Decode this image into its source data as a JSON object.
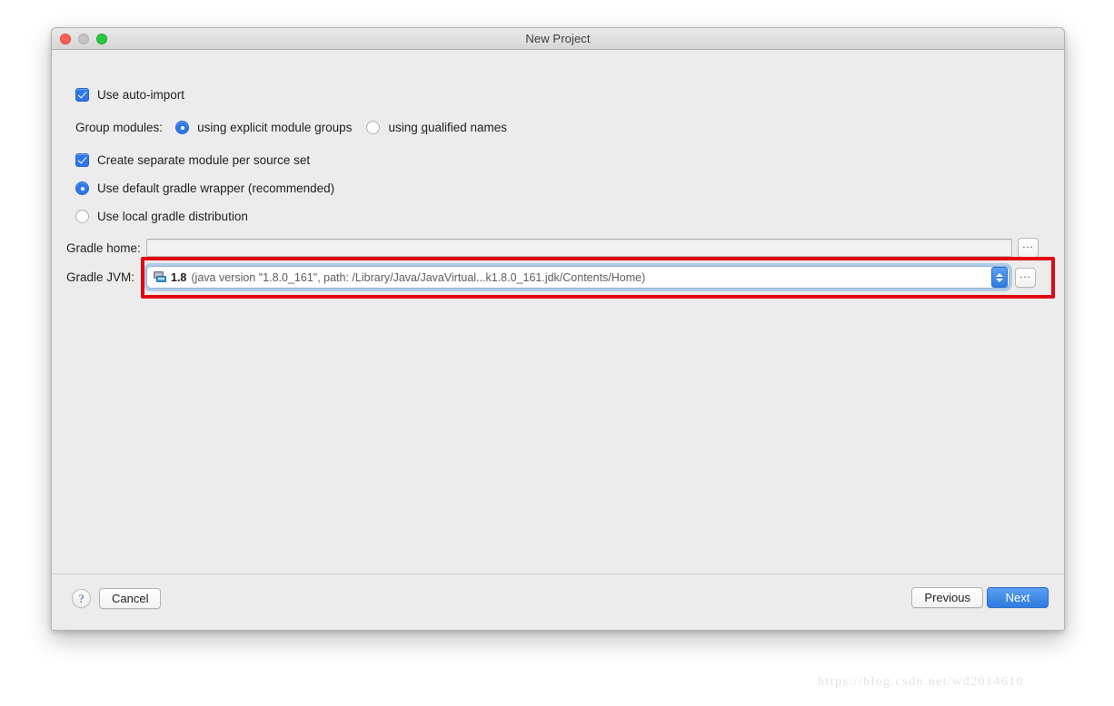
{
  "window": {
    "title": "New Project",
    "traffic_lights": [
      "close-button",
      "minimize-button",
      "zoom-button"
    ]
  },
  "form": {
    "auto_import": {
      "label": "Use auto-import",
      "checked": true
    },
    "group_modules": {
      "label": "Group modules:",
      "options": [
        {
          "label_pre": "using explicit module ",
          "mnemonic": "g",
          "label_post": "roups",
          "selected": true
        },
        {
          "label_pre": "using ",
          "mnemonic": "q",
          "label_post": "ualified names",
          "selected": false
        }
      ]
    },
    "separate_module": {
      "label": "Create separate module per source set",
      "checked": true
    },
    "gradle_wrapper": {
      "label": "Use default gradle wrapper (recommended)",
      "selected": true
    },
    "local_distribution": {
      "label": "Use local gradle distribution",
      "selected": false
    },
    "gradle_home": {
      "label": "Gradle home:",
      "value": "",
      "placeholder": "",
      "browse_label": "..."
    },
    "gradle_jvm": {
      "label": "Gradle JVM:",
      "icon": "jdk-computer-icon",
      "version": "1.8",
      "details": "(java version \"1.8.0_161\", path: /Library/Java/JavaVirtual...k1.8.0_161.jdk/Contents/Home)",
      "browse_label": "...",
      "highlighted": true,
      "highlight_color": "#e30613"
    }
  },
  "footer": {
    "help_label": "?",
    "cancel_label": "Cancel",
    "previous_label": "Previous",
    "next_label": "Next"
  },
  "watermark": {
    "text": "https://blog.csdn.net/wd2014610"
  },
  "colors": {
    "accent": "#2f77e8",
    "primary_button": "#2f7be0",
    "annotation": "#e30613",
    "window_bg": "#ececec"
  }
}
